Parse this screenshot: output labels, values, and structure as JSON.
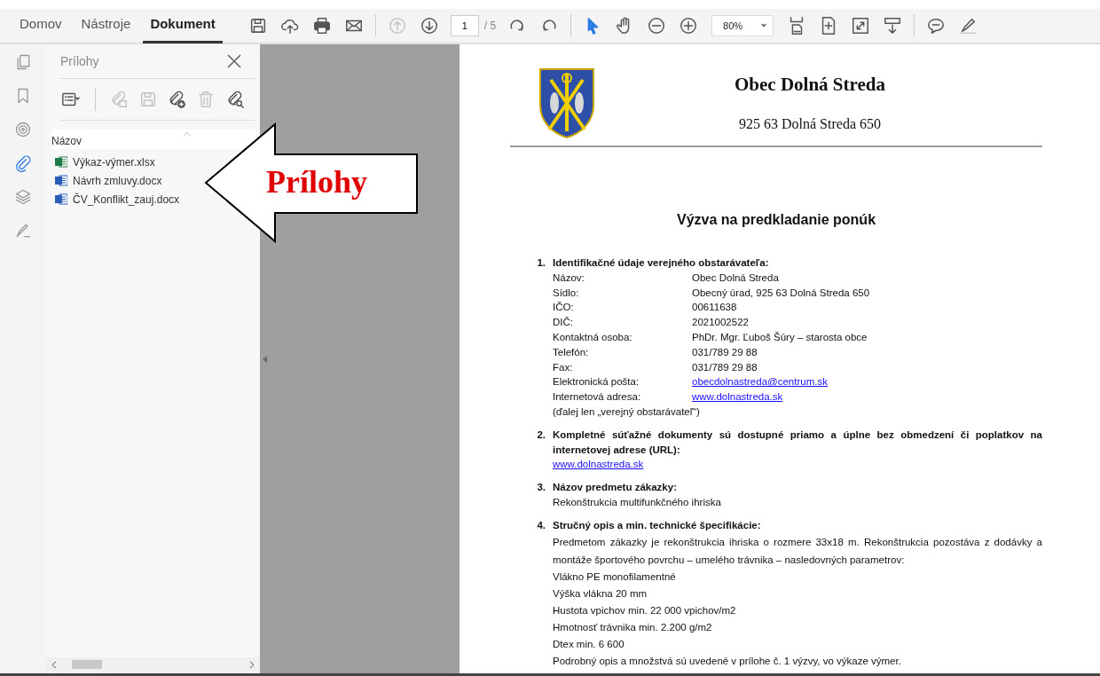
{
  "toolbar": {
    "tabs": [
      {
        "label": "Domov",
        "selected": false
      },
      {
        "label": "Nástroje",
        "selected": false
      },
      {
        "label": "Dokument",
        "selected": true
      }
    ],
    "tools": [
      {
        "kind": "save",
        "disabled": false,
        "selected": false
      },
      {
        "kind": "cloud-upload",
        "disabled": false,
        "selected": false
      },
      {
        "kind": "print",
        "disabled": false,
        "selected": false
      },
      {
        "kind": "mail",
        "disabled": false,
        "selected": false
      },
      {
        "kind": "separator"
      },
      {
        "kind": "prev-page",
        "disabled": true,
        "selected": false
      },
      {
        "kind": "next-page",
        "disabled": false,
        "selected": false
      },
      {
        "kind": "page-field",
        "value": "1",
        "total": "/ 5"
      },
      {
        "kind": "rotate-cw",
        "disabled": false,
        "selected": false
      },
      {
        "kind": "rotate-ccw",
        "disabled": false,
        "selected": false
      },
      {
        "kind": "separator"
      },
      {
        "kind": "select",
        "disabled": false,
        "selected": true
      },
      {
        "kind": "hand",
        "disabled": false,
        "selected": false
      },
      {
        "kind": "zoom-out",
        "disabled": false,
        "selected": false
      },
      {
        "kind": "zoom-in",
        "disabled": false,
        "selected": false
      },
      {
        "kind": "zoom-select",
        "value": "80%"
      },
      {
        "kind": "fit-width",
        "disabled": false,
        "selected": false
      },
      {
        "kind": "fit-page",
        "disabled": false,
        "selected": false
      },
      {
        "kind": "fullscreen",
        "disabled": false,
        "selected": false
      },
      {
        "kind": "scroll-mode",
        "disabled": false,
        "selected": false
      },
      {
        "kind": "separator"
      },
      {
        "kind": "comment",
        "disabled": false,
        "selected": false
      },
      {
        "kind": "highlight",
        "disabled": false,
        "selected": false
      }
    ]
  },
  "rail": [
    {
      "kind": "pages",
      "selected": false
    },
    {
      "kind": "bookmark",
      "selected": false
    },
    {
      "kind": "target",
      "selected": false
    },
    {
      "kind": "paperclip",
      "selected": true
    },
    {
      "kind": "layers",
      "selected": false
    },
    {
      "kind": "signature",
      "selected": false
    }
  ],
  "panel": {
    "title": "Prílohy",
    "tools": [
      {
        "kind": "list-options",
        "disabled": false
      },
      {
        "kind": "clip-open",
        "disabled": true
      },
      {
        "kind": "save",
        "disabled": true
      },
      {
        "kind": "clip-add",
        "disabled": false
      },
      {
        "kind": "trash",
        "disabled": true
      },
      {
        "kind": "clip-search",
        "disabled": false
      }
    ],
    "column": "Názov",
    "files": [
      {
        "name": "Výkaz-výmer.xlsx",
        "kind": "xlsx"
      },
      {
        "name": "Návrh zmluvy.docx",
        "kind": "docx"
      },
      {
        "name": "ČV_Konflikt_zauj.docx",
        "kind": "docx"
      }
    ]
  },
  "callout": {
    "text": "Prílohy"
  },
  "document": {
    "org_name": "Obec Dolná Streda",
    "org_address": "925 63 Dolná Streda 650",
    "title": "Výzva na predkladanie ponúk",
    "sections": [
      {
        "number": "1.",
        "heading": "Identifikačné údaje verejného obstarávateľa:",
        "fields": [
          {
            "label": "Názov:",
            "value": "Obec Dolná Streda",
            "kind": "text"
          },
          {
            "label": "Sídlo:",
            "value": "Obecný úrad, 925 63 Dolná Streda 650",
            "kind": "text"
          },
          {
            "label": "IČO:",
            "value": "00611638",
            "kind": "text"
          },
          {
            "label": "DIČ:",
            "value": "2021002522",
            "kind": "text"
          },
          {
            "label": "Kontaktná osoba:",
            "value": "PhDr. Mgr. Ľuboš Šúry – starosta obce",
            "kind": "text"
          },
          {
            "label": "Telefón:",
            "value": "031/789 29 88",
            "kind": "text"
          },
          {
            "label": "Fax:",
            "value": "031/789 29 88",
            "kind": "text"
          },
          {
            "label": "Elektronická pošta:",
            "value": "obecdolnastreda@centrum.sk",
            "kind": "link"
          },
          {
            "label": "Internetová adresa:",
            "value": "www.dolnastreda.sk",
            "kind": "link"
          }
        ],
        "body": [
          {
            "kind": "text",
            "text": "(ďalej len „verejný obstarávateľ“)"
          }
        ]
      },
      {
        "number": "2.",
        "heading": "Kompletné súťažné dokumenty sú dostupné priamo a úplne bez obmedzení či poplatkov na internetovej adrese (URL):",
        "body": [
          {
            "kind": "link",
            "text": "www.dolnastreda.sk"
          }
        ]
      },
      {
        "number": "3.",
        "heading": "Názov predmetu zákazky:",
        "body": [
          {
            "kind": "text",
            "text": "Rekonštrukcia multifunkčného ihriska"
          }
        ]
      },
      {
        "number": "4.",
        "heading": "Stručný opis a min. technické špecifikácie:",
        "body": [
          {
            "kind": "para",
            "text": "Predmetom zákazky je rekonštrukcia ihriska o rozmere 33x18 m. Rekonštrukcia pozostáva z dodávky a montáže športového povrchu – umelého trávnika – nasledovných parametrov:"
          },
          {
            "kind": "line",
            "text": "Vlákno PE monofilamentné"
          },
          {
            "kind": "line",
            "text": "Výška vlákna  20 mm"
          },
          {
            "kind": "line",
            "text": "Hustota vpichov min. 22 000 vpichov/m2"
          },
          {
            "kind": "line",
            "text": "Hmotnosť trávnika min. 2.200 g/m2"
          },
          {
            "kind": "line",
            "text": "Dtex min. 6 600"
          },
          {
            "kind": "line",
            "text": "Podrobný opis a množstvá sú uvedené v prílohe č. 1 výzvy, vo výkaze výmer."
          }
        ]
      }
    ]
  }
}
